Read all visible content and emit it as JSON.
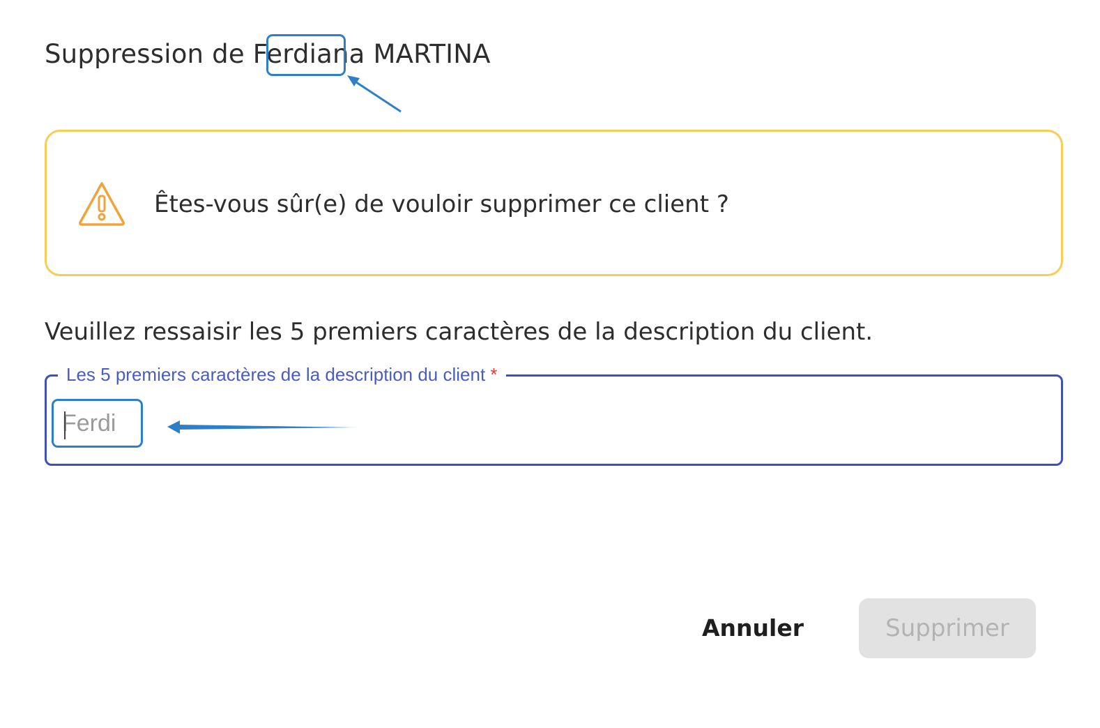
{
  "dialog": {
    "title": "Suppression de Ferdiana MARTINA"
  },
  "warning": {
    "icon": "warning-triangle-icon",
    "color": "#f6cd56",
    "message": "Êtes-vous sûr(e) de vouloir supprimer ce client ?"
  },
  "instruction": "Veuillez ressaisir les 5 premiers caractères de la description du client.",
  "field": {
    "label": "Les 5 premiers caractères de la description du client",
    "required_marker": "*",
    "placeholder": "Ferdi",
    "value": "",
    "accent_color": "#3f51b5"
  },
  "actions": {
    "cancel_label": "Annuler",
    "delete_label": "Supprimer",
    "delete_disabled": true
  },
  "annotations": {
    "color": "#2f7fc8"
  }
}
